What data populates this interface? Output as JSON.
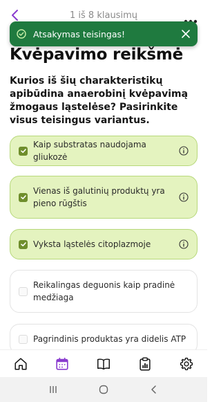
{
  "header": {
    "progress": "1 iš 8 klausimų"
  },
  "toast": {
    "message": "Atsakymas teisingas!"
  },
  "page": {
    "title": "Kvėpavimo reikšmė",
    "question": "Kurios iš šių charakteristikų apibūdina anaerobinį kvėpavimą žmogaus ląstelėse? Pasirinkite visus teisingus variantus."
  },
  "options": [
    {
      "label": "Kaip substratas naudojama gliukozė",
      "checked": true
    },
    {
      "label": "Vienas iš galutinių produktų yra pieno rūgštis",
      "checked": true
    },
    {
      "label": "Vyksta ląstelės citoplazmoje",
      "checked": true
    },
    {
      "label": "Reikalingas deguonis kaip pradinė medžiaga",
      "checked": false
    },
    {
      "label": "Pagrindinis produktas yra didelis ATP",
      "checked": false
    }
  ],
  "colors": {
    "accent": "#8a3ccf",
    "toast_bg": "#1f7a3f",
    "correct_bg": "#e4f3bf",
    "correct_border": "#b7d87a",
    "checkbox": "#6f8e2c"
  },
  "nav": {
    "items": [
      "home-icon",
      "calendar-icon",
      "book-icon",
      "clipboard-chart-icon",
      "gear-icon"
    ],
    "active": "calendar-icon"
  }
}
